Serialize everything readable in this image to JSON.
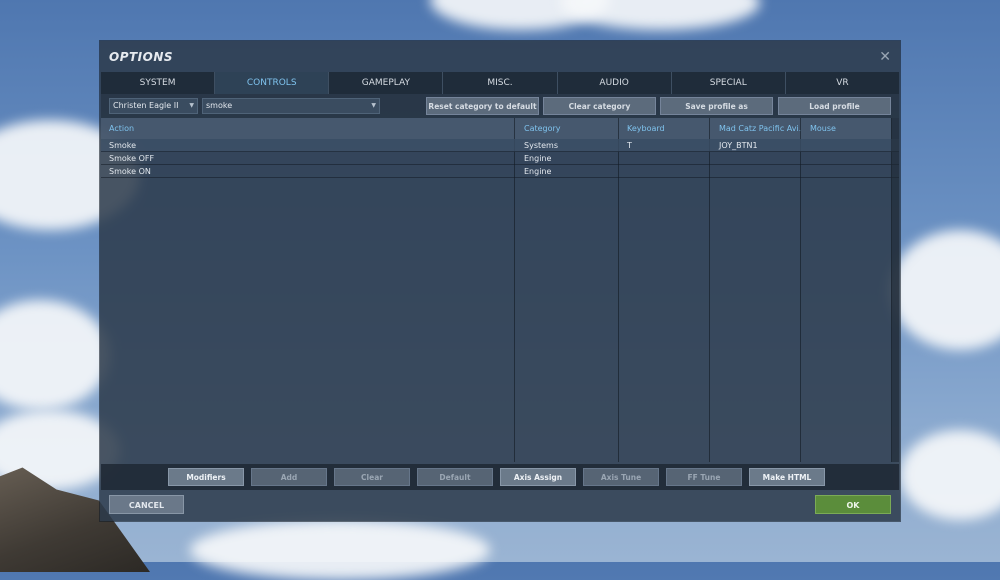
{
  "window": {
    "title": "OPTIONS"
  },
  "tabs": [
    {
      "label": "SYSTEM"
    },
    {
      "label": "CONTROLS"
    },
    {
      "label": "GAMEPLAY"
    },
    {
      "label": "MISC."
    },
    {
      "label": "AUDIO"
    },
    {
      "label": "SPECIAL"
    },
    {
      "label": "VR"
    }
  ],
  "active_tab": "CONTROLS",
  "filters": {
    "aircraft": "Christen Eagle II",
    "search": "smoke"
  },
  "toolbar": {
    "reset_category": "Reset category to default",
    "clear_category": "Clear category",
    "save_profile": "Save profile as",
    "load_profile": "Load profile"
  },
  "table": {
    "headers": {
      "action": "Action",
      "category": "Category",
      "keyboard": "Keyboard",
      "device": "Mad Catz Pacific Avi...",
      "mouse": "Mouse"
    },
    "rows": [
      {
        "action": "Smoke",
        "category": "Systems",
        "keyboard": "T",
        "device": "JOY_BTN1",
        "mouse": ""
      },
      {
        "action": "Smoke OFF",
        "category": "Engine",
        "keyboard": "",
        "device": "",
        "mouse": ""
      },
      {
        "action": "Smoke ON",
        "category": "Engine",
        "keyboard": "",
        "device": "",
        "mouse": ""
      }
    ]
  },
  "bottom_buttons": {
    "modifiers": "Modifiers",
    "add": "Add",
    "clear": "Clear",
    "default": "Default",
    "axis_assign": "Axis Assign",
    "axis_tune": "Axis Tune",
    "ff_tune": "FF Tune",
    "make_html": "Make HTML"
  },
  "footer": {
    "cancel": "CANCEL",
    "ok": "OK"
  },
  "colors": {
    "accent": "#7fc3ee",
    "ok_green": "#5b8d3b"
  }
}
